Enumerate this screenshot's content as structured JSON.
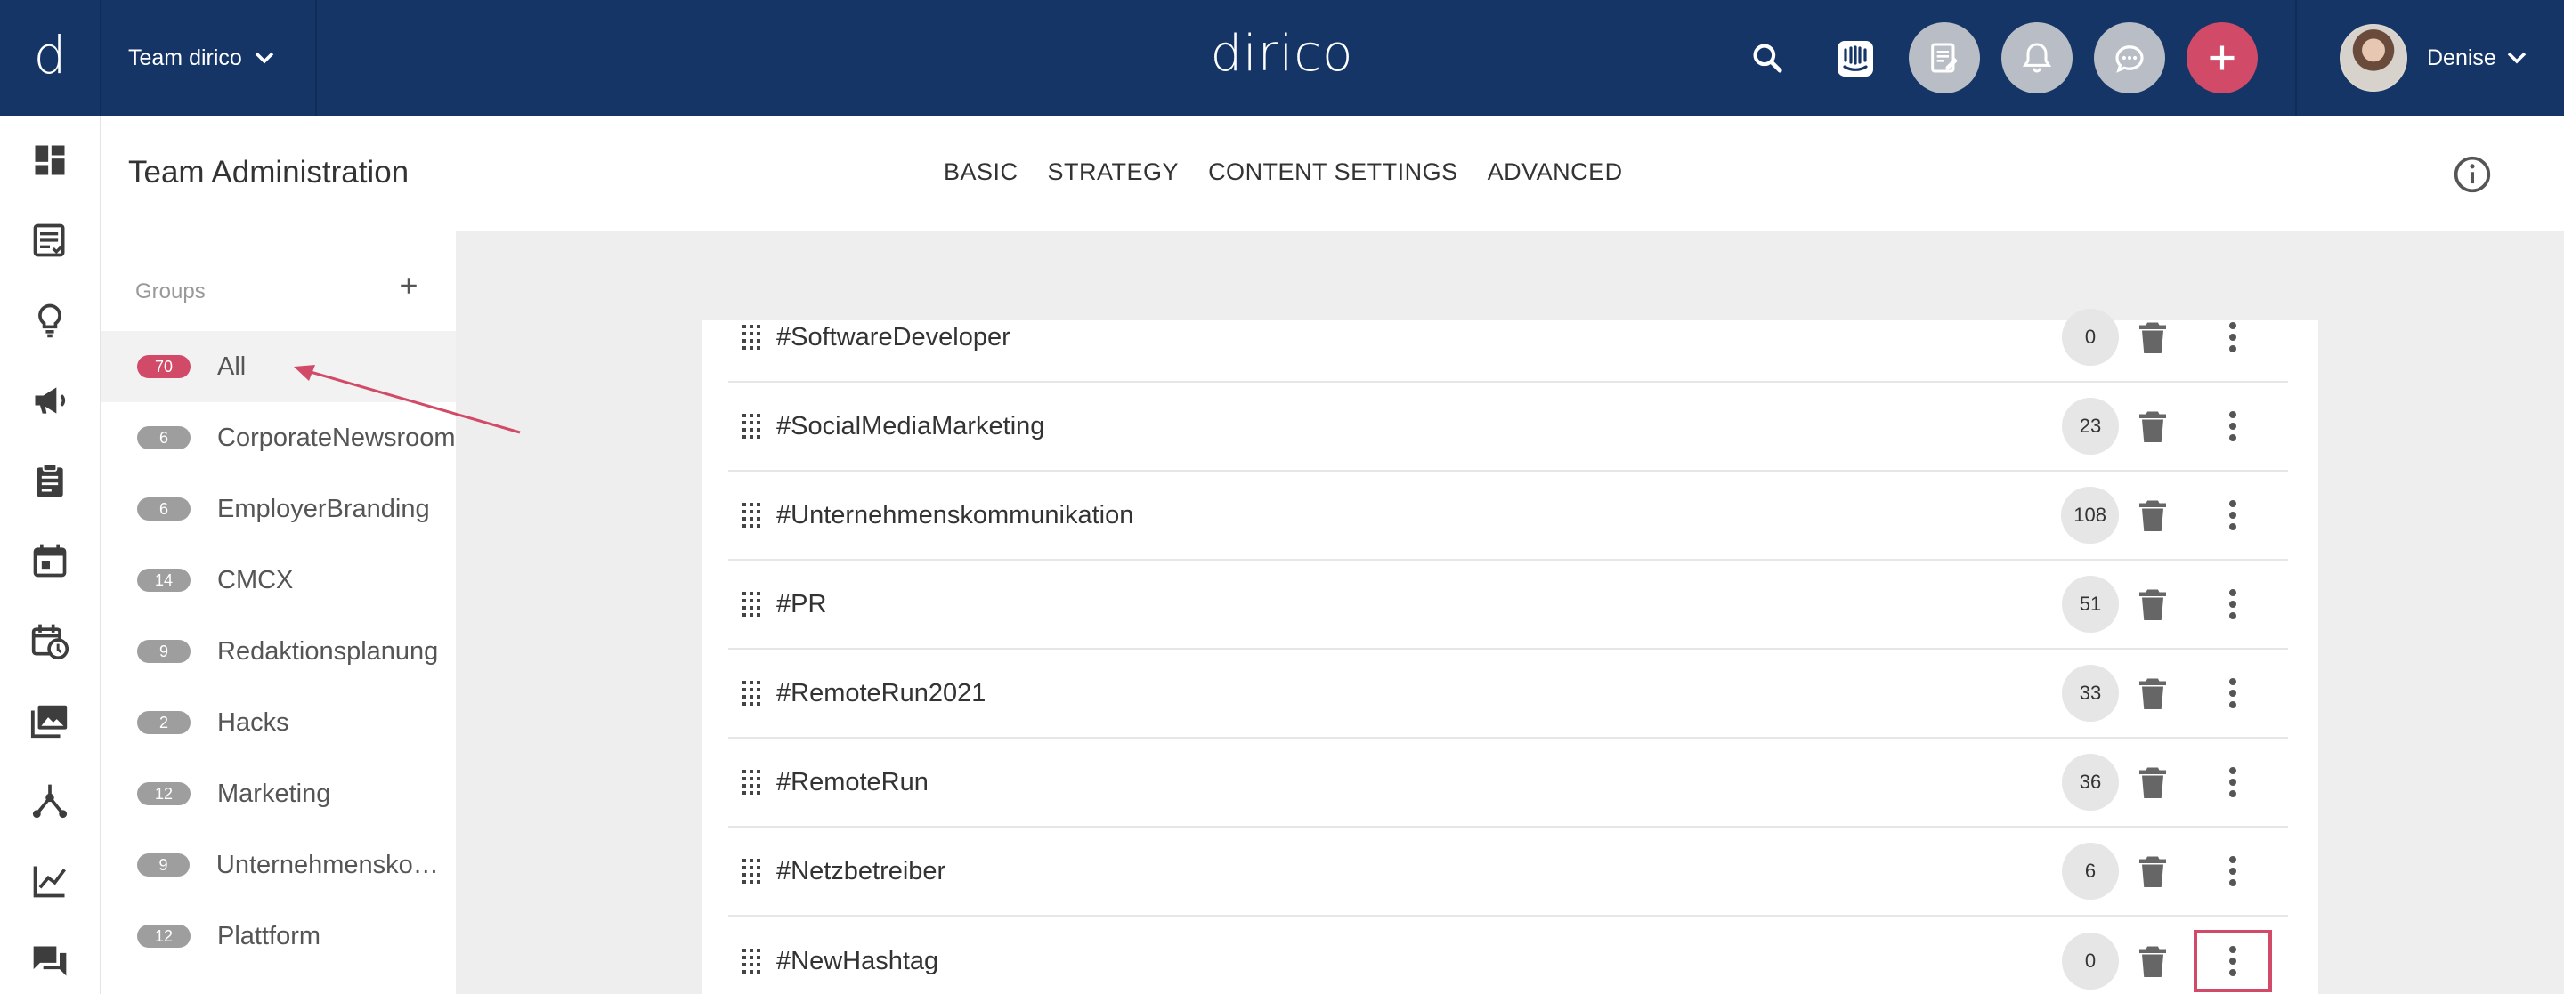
{
  "app": {
    "brand": "dirico",
    "logo_letter": "d"
  },
  "topbar": {
    "team_label": "Team dirico",
    "user_name": "Denise",
    "icons": [
      "search-icon",
      "intercom-icon",
      "tasks-icon",
      "bell-icon",
      "chat-icon",
      "plus-icon"
    ]
  },
  "leftnav": {
    "items": [
      "dashboard-icon",
      "posts-icon",
      "ideas-icon",
      "campaigns-icon",
      "clipboard-icon",
      "calendar-icon",
      "schedule-icon",
      "media-icon",
      "network-icon",
      "analytics-icon",
      "messages-icon"
    ]
  },
  "page": {
    "title": "Team Administration",
    "tabs": [
      "BASIC",
      "STRATEGY",
      "CONTENT SETTINGS",
      "ADVANCED"
    ]
  },
  "groups": {
    "heading": "Groups",
    "items": [
      {
        "count": "70",
        "name": "All",
        "active": true
      },
      {
        "count": "6",
        "name": "CorporateNewsroom"
      },
      {
        "count": "6",
        "name": "EmployerBranding"
      },
      {
        "count": "14",
        "name": "CMCX"
      },
      {
        "count": "9",
        "name": "Redaktionsplanung"
      },
      {
        "count": "2",
        "name": "Hacks"
      },
      {
        "count": "12",
        "name": "Marketing"
      },
      {
        "count": "9",
        "name": "Unternehmenskom…"
      },
      {
        "count": "12",
        "name": "Plattform"
      }
    ]
  },
  "hashtags": [
    {
      "tag": "#SoftwareDeveloper",
      "count": "0"
    },
    {
      "tag": "#SocialMediaMarketing",
      "count": "23"
    },
    {
      "tag": "#Unternehmenskommunikation",
      "count": "108"
    },
    {
      "tag": "#PR",
      "count": "51"
    },
    {
      "tag": "#RemoteRun2021",
      "count": "33"
    },
    {
      "tag": "#RemoteRun",
      "count": "36"
    },
    {
      "tag": "#Netzbetreiber",
      "count": "6"
    },
    {
      "tag": "#NewHashtag",
      "count": "0"
    }
  ],
  "colors": {
    "topbar": "#163567",
    "accent": "#d14a68",
    "badge_gray": "#9e9e9e"
  }
}
